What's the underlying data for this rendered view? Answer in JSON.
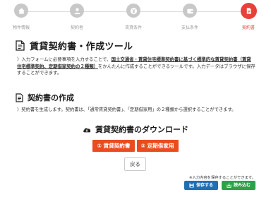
{
  "steps": [
    {
      "label": "物件情報",
      "icon": "house-icon",
      "active": false
    },
    {
      "label": "契約者",
      "icon": "person-icon",
      "active": false
    },
    {
      "label": "賃貸条件",
      "icon": "yen-icon",
      "active": false
    },
    {
      "label": "支払条件",
      "icon": "wallet-icon",
      "active": false
    },
    {
      "label": "契約書",
      "icon": "document-icon",
      "active": true
    }
  ],
  "title": "賃貸契約書・作成ツール",
  "intro": {
    "prefix": "〉入力フォームに必要事項を入力することで、",
    "highlight": "国土交通省・賃貸住宅標準契約書に基づく標準的な賃貸契約書（賃貸住宅標準契約、定期借家契約の２種類）",
    "suffix": "をかんたんに作成することができるツールです。入力データはブラウザに保存することができます。"
  },
  "section": {
    "title": "契約書の作成",
    "text": "〉契約書を生成します。契約書は、「通常賃貸契約書」、「定期借家用」の２種類から選択することができます。"
  },
  "download": {
    "title": "賃貸契約書のダウンロード",
    "buttons": [
      "① 賃貸契約書 ",
      "② 定期借家用 "
    ]
  },
  "back_label": "戻る",
  "save_note": "※入力内容を保存することができます。",
  "save_label": "保存する",
  "load_label": "読み込む",
  "colors": {
    "accent": "#e8403a",
    "download": "#ea4b1f",
    "save": "#1f6fb5",
    "load": "#2da145"
  }
}
